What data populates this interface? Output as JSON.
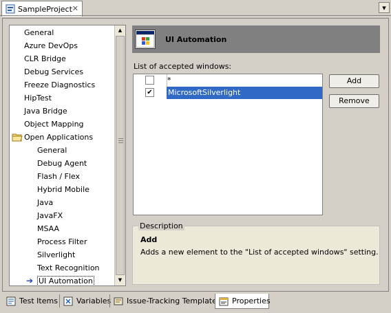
{
  "editor_tab": {
    "title": "SampleProject",
    "close": "✕"
  },
  "tab_menu": "▾",
  "tree": {
    "items": [
      {
        "label": "General",
        "level": 0
      },
      {
        "label": "Azure DevOps",
        "level": 0
      },
      {
        "label": "CLR Bridge",
        "level": 0
      },
      {
        "label": "Debug Services",
        "level": 0
      },
      {
        "label": "Freeze Diagnostics",
        "level": 0
      },
      {
        "label": "HipTest",
        "level": 0
      },
      {
        "label": "Java Bridge",
        "level": 0
      },
      {
        "label": "Object Mapping",
        "level": 0
      },
      {
        "label": "Open Applications",
        "level": 0,
        "folder": true
      },
      {
        "label": "General",
        "level": 1
      },
      {
        "label": "Debug Agent",
        "level": 1
      },
      {
        "label": "Flash / Flex",
        "level": 1
      },
      {
        "label": "Hybrid Mobile",
        "level": 1
      },
      {
        "label": "Java",
        "level": 1
      },
      {
        "label": "JavaFX",
        "level": 1
      },
      {
        "label": "MSAA",
        "level": 1
      },
      {
        "label": "Process Filter",
        "level": 1
      },
      {
        "label": "Silverlight",
        "level": 1
      },
      {
        "label": "Text Recognition",
        "level": 1
      },
      {
        "label": "UI Automation",
        "level": 1,
        "selected": true
      }
    ]
  },
  "header": {
    "title": "UI Automation"
  },
  "windows_list": {
    "label": "List of accepted windows:",
    "rows": [
      {
        "checked": false,
        "text": "*"
      },
      {
        "checked": true,
        "text": "MicrosoftSilverlight"
      }
    ]
  },
  "buttons": {
    "add": "Add",
    "remove": "Remove"
  },
  "description": {
    "caption": "Description",
    "title": "Add",
    "body": "Adds a new element to the \"List of accepted windows\" setting."
  },
  "bottom_tabs": [
    {
      "label": "Test Items",
      "active": false
    },
    {
      "label": "Variables",
      "active": false
    },
    {
      "label": "Issue-Tracking Templates",
      "active": false
    },
    {
      "label": "Properties",
      "active": true
    }
  ],
  "colors": {
    "selection": "#3169c6",
    "header_bar": "#808080",
    "window_bg": "#d4d0c8"
  }
}
